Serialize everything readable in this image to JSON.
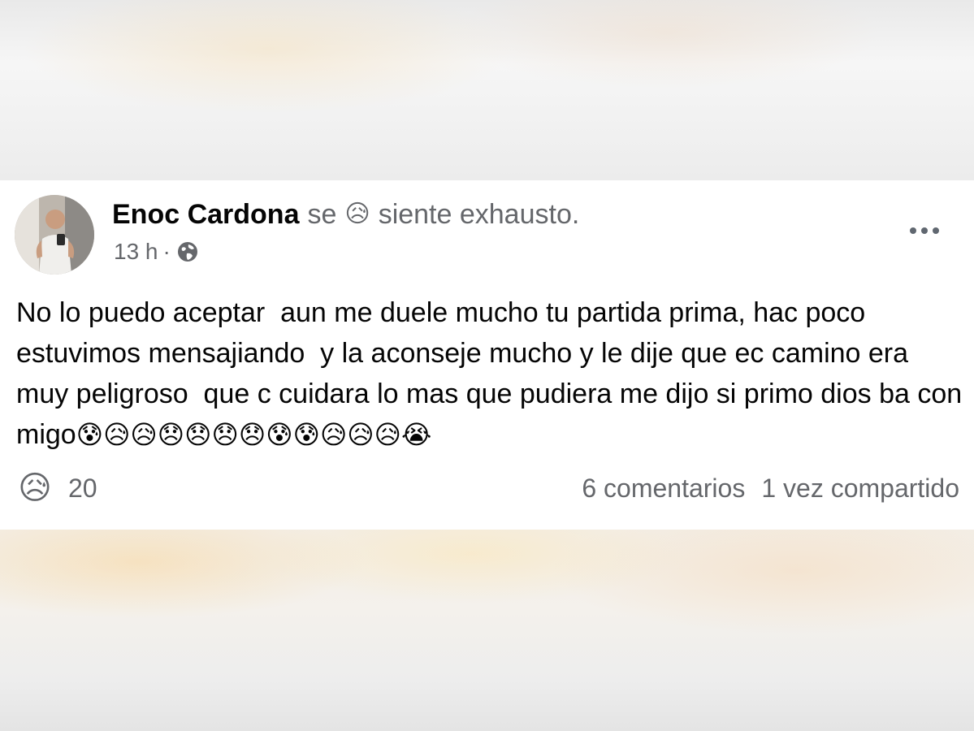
{
  "post": {
    "author_name": "Enoc Cardona",
    "feeling_prefix": "se",
    "feeling_emoji": "😥",
    "feeling_text": "siente exhausto.",
    "timestamp": "13 h",
    "meta_separator": "·",
    "privacy_icon": "globe-icon",
    "more_icon": "more-options-icon",
    "body_text": "No lo puedo aceptar  aun me duele mucho tu partida prima, hac poco estuvimos mensajiando  y la aconseje mucho y le dije que ec camino era muy peligroso  que c cuidara lo mas que pudiera me dijo si primo dios ba con migo",
    "body_emojis": "😰😥😥😞😞😞😞😰😰😥😥😥😭"
  },
  "footer": {
    "reaction_emoji": "😥",
    "reaction_count": "20",
    "comments": "6 comentarios",
    "shares": "1 vez compartido"
  },
  "colors": {
    "text_primary": "#050505",
    "text_secondary": "#65676b",
    "card_background": "#ffffff"
  }
}
